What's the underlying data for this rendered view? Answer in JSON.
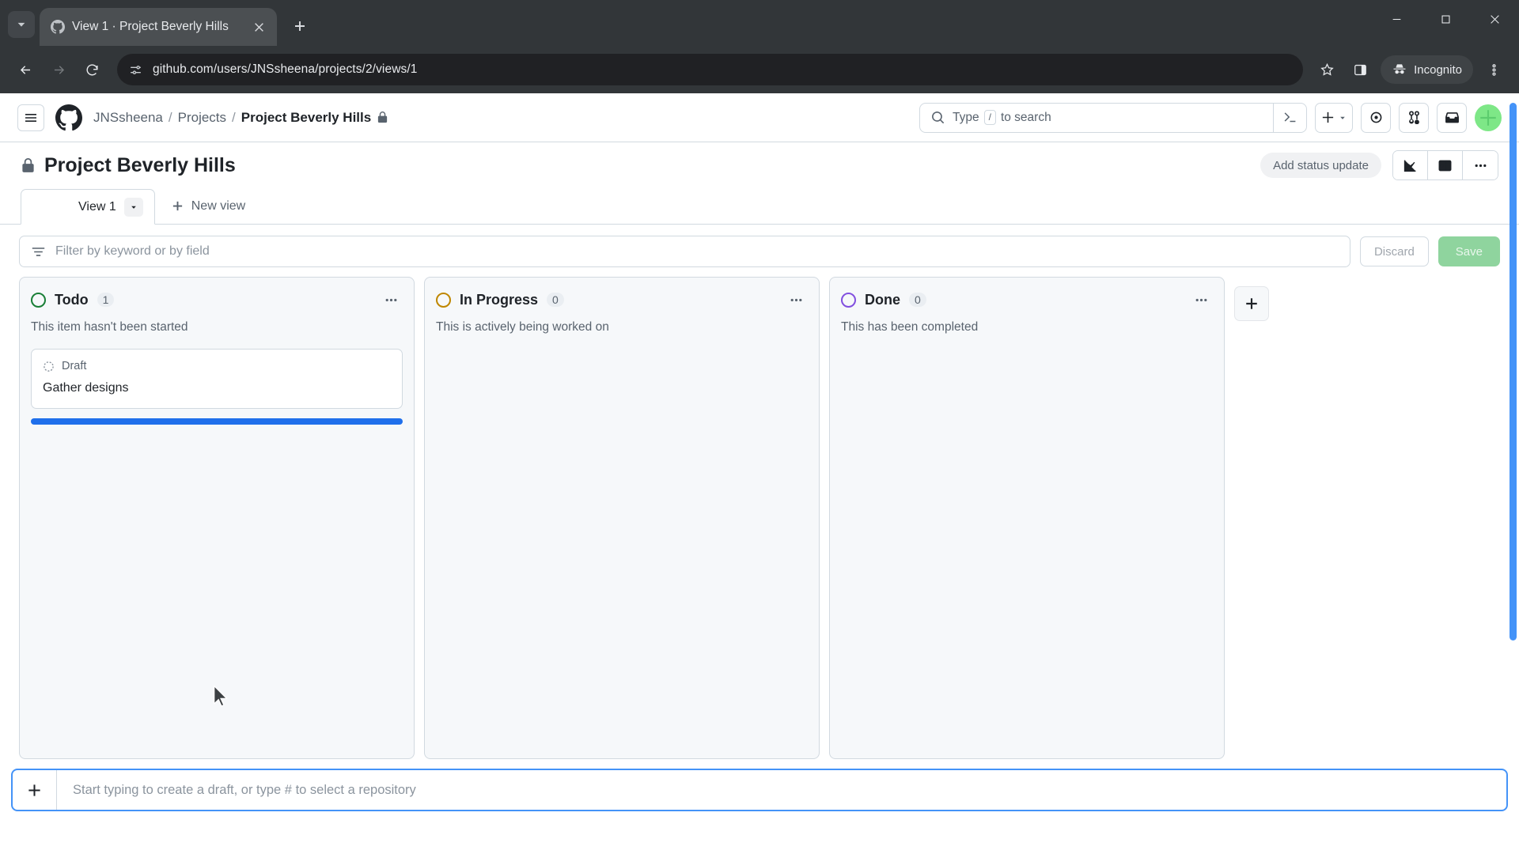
{
  "browser": {
    "tab": {
      "title": "View 1 · Project Beverly Hills",
      "favicon_icon": "github-favicon",
      "close_icon": "close-icon"
    },
    "tab_search_icon": "tab-search-chevron-icon",
    "new_tab_icon": "plus-icon",
    "window": {
      "minimize_icon": "minimize-icon",
      "maximize_icon": "maximize-icon",
      "close_icon": "window-close-icon"
    },
    "nav": {
      "back_icon": "back-arrow-icon",
      "forward_icon": "forward-arrow-icon",
      "reload_icon": "reload-icon"
    },
    "omnibox": {
      "url": "github.com/users/JNSsheena/projects/2/views/1",
      "site_info_icon": "site-settings-icon"
    },
    "actions": {
      "bookmark_icon": "bookmark-star-icon",
      "side_panel_icon": "side-panel-icon",
      "incognito_label": "Incognito",
      "incognito_icon": "incognito-hat-icon",
      "menu_icon": "kebab-menu-icon"
    }
  },
  "github": {
    "header": {
      "menu_icon": "hamburger-icon",
      "logo_icon": "github-mark-icon",
      "breadcrumb": {
        "owner": "JNSsheena",
        "section": "Projects",
        "current": "Project Beverly Hills",
        "separator": "/",
        "private_icon": "lock-icon"
      },
      "search": {
        "placeholder_prefix": "Type",
        "key_hint": "/",
        "placeholder_suffix": "to search",
        "search_icon": "search-icon",
        "terminal_icon": "terminal-icon"
      },
      "actions": {
        "create_icon": "plus-icon",
        "create_caret_icon": "chevron-down-icon",
        "issues_icon": "issue-opened-icon",
        "pull_requests_icon": "git-pull-request-icon",
        "inbox_icon": "inbox-icon",
        "avatar_icon": "user-avatar",
        "avatar_color": "#7ee787"
      }
    },
    "project": {
      "title": "Project Beverly Hills",
      "visibility_icon": "lock-icon",
      "status_update_label": "Add status update",
      "insights_icon": "line-chart-icon",
      "side_panel_icon": "project-side-panel-icon",
      "more_icon": "kebab-horizontal-icon"
    },
    "views": {
      "tabs": [
        {
          "label": "View 1",
          "icon": "project-board-icon",
          "caret_icon": "chevron-down-icon",
          "active": true
        }
      ],
      "new_view_label": "New view",
      "new_view_icon": "plus-icon"
    },
    "filter": {
      "placeholder": "Filter by keyword or by field",
      "filter_icon": "filter-icon",
      "discard_label": "Discard",
      "save_label": "Save",
      "save_color": "#8fd49e"
    },
    "board": {
      "columns": [
        {
          "name": "Todo",
          "count": "1",
          "description": "This item hasn't been started",
          "color": "#1a7f37",
          "menu_icon": "kebab-horizontal-icon",
          "cards": [
            {
              "badge": "Draft",
              "badge_icon": "draft-circle-icon",
              "title": "Gather designs"
            }
          ],
          "drop_indicator": true,
          "drop_indicator_color": "#1f6feb"
        },
        {
          "name": "In Progress",
          "count": "0",
          "description": "This is actively being worked on",
          "color": "#bf8700",
          "menu_icon": "kebab-horizontal-icon",
          "cards": [],
          "drop_indicator": false
        },
        {
          "name": "Done",
          "count": "0",
          "description": "This has been completed",
          "color": "#8250df",
          "menu_icon": "kebab-horizontal-icon",
          "cards": [],
          "drop_indicator": false
        }
      ],
      "add_column_icon": "plus-icon"
    },
    "draft_input": {
      "placeholder": "Start typing to create a draft, or type # to select a repository",
      "add_icon": "plus-icon"
    },
    "scrollbar_color": "#4493f8"
  }
}
